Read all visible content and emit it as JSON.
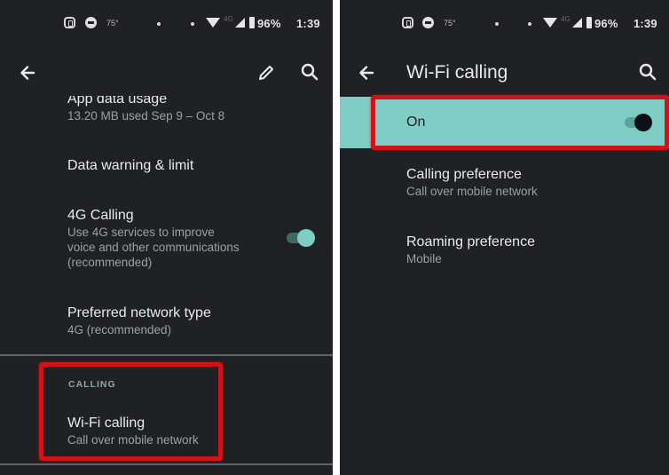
{
  "status_bar": {
    "temperature": "75°",
    "network_type": "4G",
    "battery": "96%",
    "time": "1:39"
  },
  "left_screen": {
    "appbar": {
      "title": "",
      "back_icon": "arrow-left-icon",
      "edit_icon": "pencil-icon",
      "search_icon": "search-icon"
    },
    "items": [
      {
        "title": "App data usage",
        "subtitle": "13.20 MB used Sep 9 – Oct 8"
      },
      {
        "title": "Data warning & limit",
        "subtitle": ""
      },
      {
        "title": "4G Calling",
        "subtitle_lines": [
          "Use 4G services to improve",
          "voice and other communications",
          "(recommended)"
        ],
        "toggle_on": true
      },
      {
        "title": "Preferred network type",
        "subtitle": "4G (recommended)"
      }
    ],
    "calling_section": {
      "label": "CALLING",
      "item": {
        "title": "Wi-Fi calling",
        "subtitle": "Call over mobile network"
      }
    }
  },
  "right_screen": {
    "appbar": {
      "title": "Wi-Fi calling",
      "back_icon": "arrow-left-icon",
      "search_icon": "search-icon"
    },
    "main_switch": {
      "label": "On",
      "toggle_on": true
    },
    "items": [
      {
        "title": "Calling preference",
        "subtitle": "Call over mobile network"
      },
      {
        "title": "Roaming preference",
        "subtitle": "Mobile"
      }
    ]
  },
  "colors": {
    "background": "#202124",
    "accent_teal": "#7fcdc4",
    "annotation_red": "#d0121b"
  }
}
